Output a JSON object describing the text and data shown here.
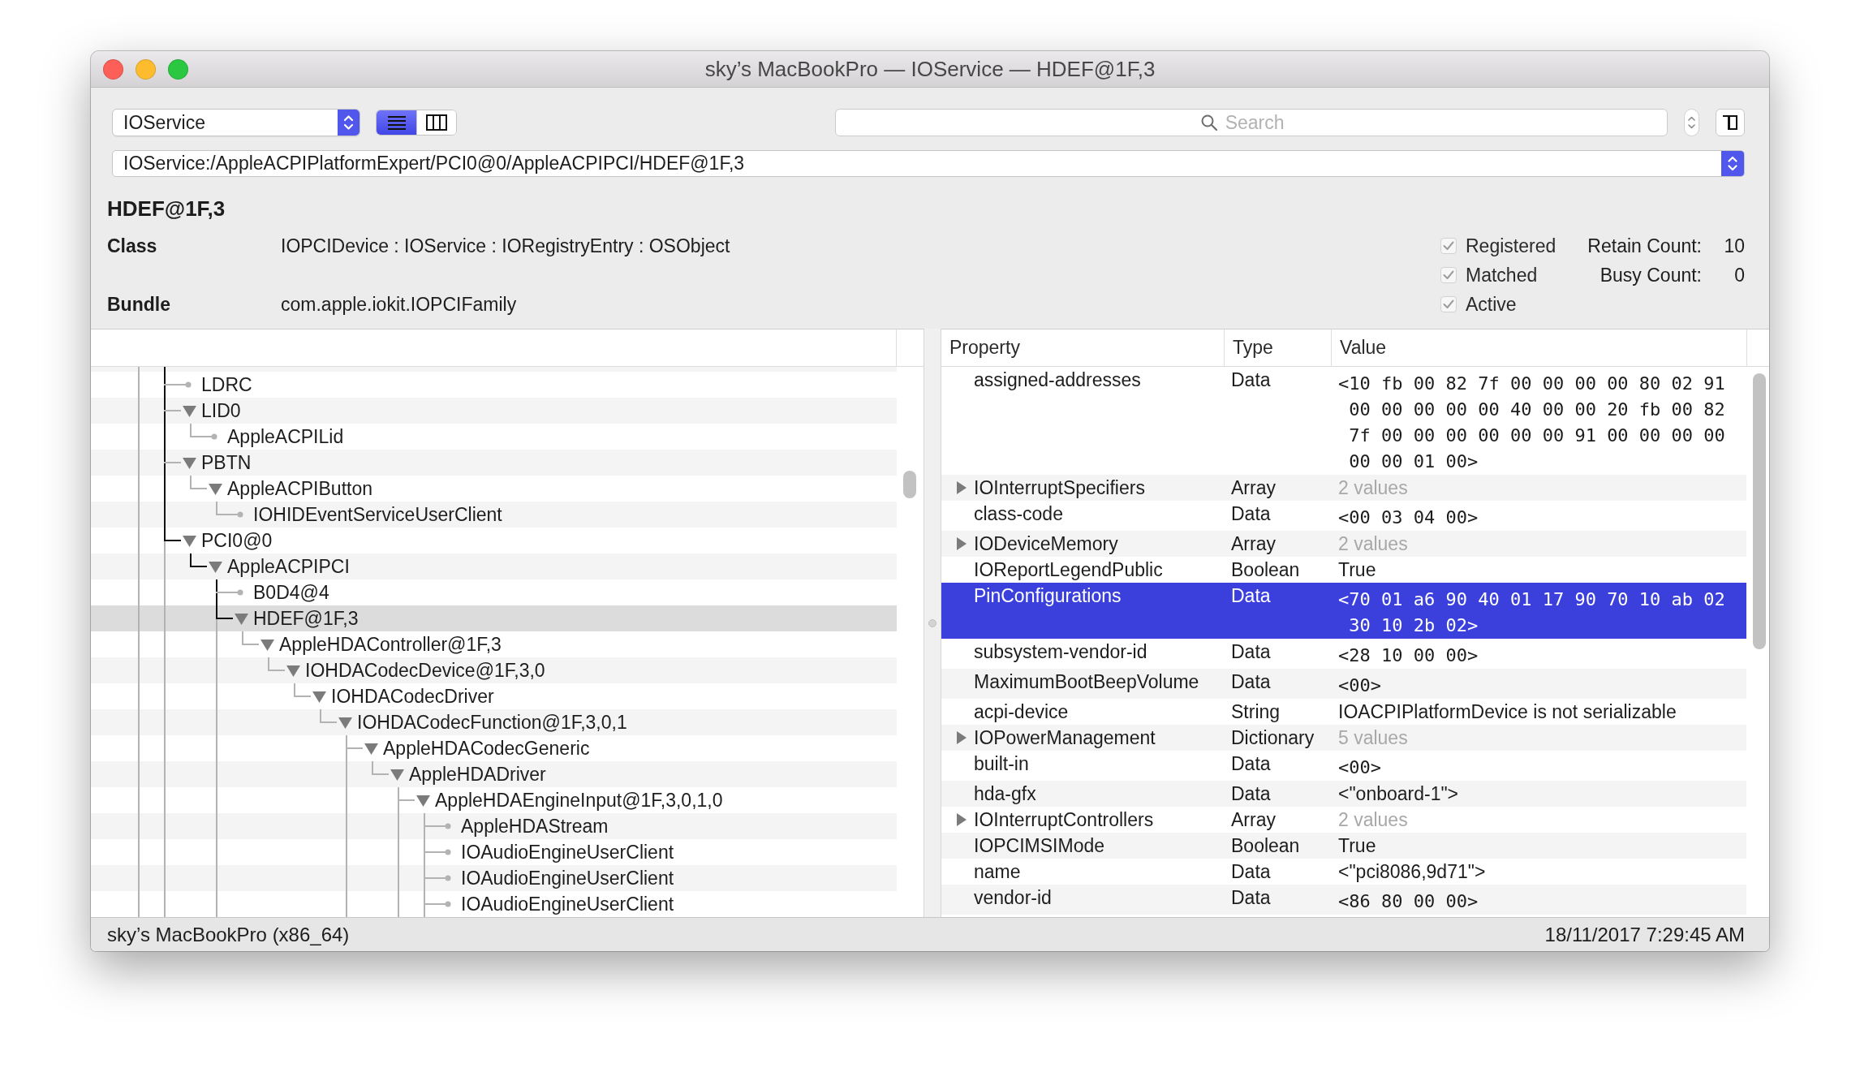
{
  "window": {
    "title": "sky’s MacBookPro — IOService — HDEF@1F,3"
  },
  "toolbar": {
    "plane_popup": {
      "value": "IOService"
    },
    "view_modes": [
      {
        "kind": "list",
        "selected": true
      },
      {
        "kind": "columns",
        "selected": false
      }
    ],
    "search": {
      "placeholder": "Search"
    },
    "path": {
      "value": "IOService:/AppleACPIPlatformExpert/PCI0@0/AppleACPIPCI/HDEF@1F,3"
    }
  },
  "info": {
    "name": "HDEF@1F,3",
    "fields": [
      {
        "label": "Class",
        "value": "IOPCIDevice : IOService : IORegistryEntry : OSObject"
      },
      {
        "label": "Bundle",
        "value": "com.apple.iokit.IOPCIFamily"
      }
    ],
    "flags": [
      {
        "label": "Registered",
        "checked": true,
        "disabled": true
      },
      {
        "label": "Matched",
        "checked": true,
        "disabled": true
      },
      {
        "label": "Active",
        "checked": true,
        "disabled": true
      }
    ],
    "counts": [
      {
        "label": "Retain Count:",
        "value": "10"
      },
      {
        "label": "Busy Count:",
        "value": "0"
      }
    ]
  },
  "tree": {
    "nodes": [
      {
        "label": "LDRC",
        "kind": "leaf",
        "selected": false,
        "has_next": true
      },
      {
        "label": "LID0",
        "kind": "node",
        "expanded": true,
        "selected": false,
        "has_next": true,
        "children": [
          {
            "label": "AppleACPILid",
            "kind": "leaf",
            "selected": false,
            "has_next": false
          }
        ]
      },
      {
        "label": "PBTN",
        "kind": "node",
        "expanded": true,
        "selected": false,
        "has_next": true,
        "children": [
          {
            "label": "AppleACPIButton",
            "kind": "node",
            "expanded": true,
            "selected": false,
            "has_next": false,
            "children": [
              {
                "label": "IOHIDEventServiceUserClient",
                "kind": "leaf",
                "selected": false,
                "has_next": false
              }
            ]
          }
        ]
      },
      {
        "label": "PCI0@0",
        "kind": "node",
        "expanded": true,
        "selected": false,
        "has_next": true,
        "children": [
          {
            "label": "AppleACPIPCI",
            "kind": "node",
            "expanded": true,
            "selected": false,
            "has_next": false,
            "children": [
              {
                "label": "B0D4@4",
                "kind": "leaf",
                "selected": false,
                "has_next": true
              },
              {
                "label": "HDEF@1F,3",
                "kind": "node",
                "expanded": true,
                "selected": true,
                "has_next": true,
                "children": [
                  {
                    "label": "AppleHDAController@1F,3",
                    "kind": "node",
                    "expanded": true,
                    "selected": false,
                    "has_next": false,
                    "children": [
                      {
                        "label": "IOHDACodecDevice@1F,3,0",
                        "kind": "node",
                        "expanded": true,
                        "selected": false,
                        "has_next": false,
                        "children": [
                          {
                            "label": "IOHDACodecDriver",
                            "kind": "node",
                            "expanded": true,
                            "selected": false,
                            "has_next": false,
                            "children": [
                              {
                                "label": "IOHDACodecFunction@1F,3,0,1",
                                "kind": "node",
                                "expanded": true,
                                "selected": false,
                                "has_next": false,
                                "children": [
                                  {
                                    "label": "AppleHDACodecGeneric",
                                    "kind": "node",
                                    "expanded": true,
                                    "selected": false,
                                    "has_next": true,
                                    "children": [
                                      {
                                        "label": "AppleHDADriver",
                                        "kind": "node",
                                        "expanded": true,
                                        "selected": false,
                                        "has_next": false,
                                        "children": [
                                          {
                                            "label": "AppleHDAEngineInput@1F,3,0,1,0",
                                            "kind": "node",
                                            "expanded": true,
                                            "selected": false,
                                            "has_next": true,
                                            "children": [
                                              {
                                                "label": "AppleHDAStream",
                                                "kind": "leaf",
                                                "selected": false,
                                                "has_next": true
                                              },
                                              {
                                                "label": "IOAudioEngineUserClient",
                                                "kind": "leaf",
                                                "selected": false,
                                                "has_next": true
                                              },
                                              {
                                                "label": "IOAudioEngineUserClient",
                                                "kind": "leaf",
                                                "selected": false,
                                                "has_next": true
                                              },
                                              {
                                                "label": "IOAudioEngineUserClient",
                                                "kind": "leaf",
                                                "selected": false,
                                                "has_next": true
                                              }
                                            ]
                                          }
                                        ]
                                      }
                                    ]
                                  }
                                ]
                              }
                            ]
                          }
                        ]
                      }
                    ]
                  }
                ]
              }
            ]
          }
        ]
      }
    ]
  },
  "properties": {
    "columns": [
      "Property",
      "Type",
      "Value"
    ],
    "rows": [
      {
        "property": "assigned-addresses",
        "type": "Data",
        "value": "<10 fb 00 82 7f 00 00 00 00 80 02 91 00 00 00 00 00 40 00 00 20 fb 00 82 7f 00 00 00 00 00 00 91 00 00 00 00 00 00 01 00>",
        "kind": "hex",
        "selected": false
      },
      {
        "property": "IOInterruptSpecifiers",
        "type": "Array",
        "value": "2 values",
        "kind": "collection",
        "expanded": false,
        "selected": false
      },
      {
        "property": "class-code",
        "type": "Data",
        "value": "<00 03 04 00>",
        "kind": "hex",
        "selected": false
      },
      {
        "property": "IODeviceMemory",
        "type": "Array",
        "value": "2 values",
        "kind": "collection",
        "expanded": false,
        "selected": false
      },
      {
        "property": "IOReportLegendPublic",
        "type": "Boolean",
        "value": "True",
        "kind": "text",
        "selected": false
      },
      {
        "property": "PinConfigurations",
        "type": "Data",
        "value": "<70 01 a6 90 40 01 17 90 70 10 ab 02 30 10 2b 02>",
        "kind": "hex",
        "selected": true
      },
      {
        "property": "subsystem-vendor-id",
        "type": "Data",
        "value": "<28 10 00 00>",
        "kind": "hex",
        "selected": false
      },
      {
        "property": "MaximumBootBeepVolume",
        "type": "Data",
        "value": "<00>",
        "kind": "hex",
        "selected": false
      },
      {
        "property": "acpi-device",
        "type": "String",
        "value": "IOACPIPlatformDevice is not serializable",
        "kind": "text",
        "selected": false
      },
      {
        "property": "IOPowerManagement",
        "type": "Dictionary",
        "value": "5 values",
        "kind": "collection",
        "expanded": false,
        "selected": false
      },
      {
        "property": "built-in",
        "type": "Data",
        "value": "<00>",
        "kind": "hex",
        "selected": false
      },
      {
        "property": "hda-gfx",
        "type": "Data",
        "value": "<\"onboard-1\">",
        "kind": "text",
        "selected": false
      },
      {
        "property": "IOInterruptControllers",
        "type": "Array",
        "value": "2 values",
        "kind": "collection",
        "expanded": false,
        "selected": false
      },
      {
        "property": "IOPCIMSIMode",
        "type": "Boolean",
        "value": "True",
        "kind": "text",
        "selected": false
      },
      {
        "property": "name",
        "type": "Data",
        "value": "<\"pci8086,9d71\">",
        "kind": "text",
        "selected": false
      },
      {
        "property": "vendor-id",
        "type": "Data",
        "value": "<86 80 00 00>",
        "kind": "hex",
        "selected": false
      }
    ]
  },
  "status_bar": {
    "machine": "sky’s MacBookPro (x86_64)",
    "timestamp": "18/11/2017 7:29:45 AM"
  }
}
